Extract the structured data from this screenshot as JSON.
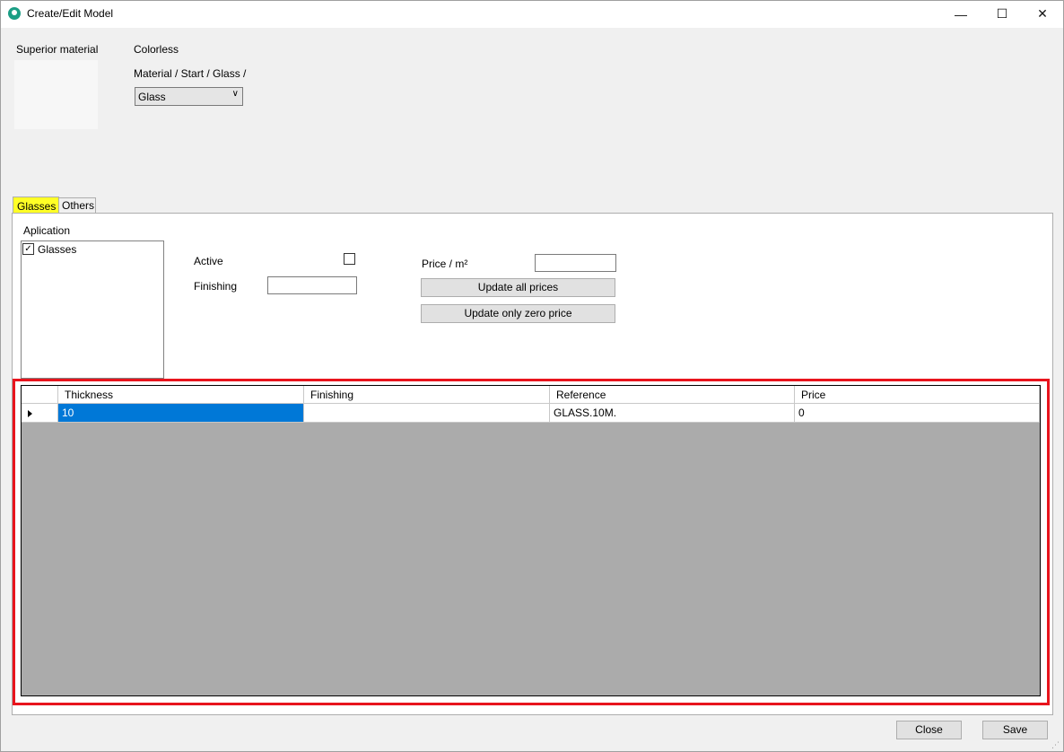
{
  "window": {
    "title": "Create/Edit Model",
    "minimize_glyph": "—",
    "maximize_glyph": "☐",
    "close_glyph": "✕"
  },
  "header": {
    "superior_material_label": "Superior material",
    "color_name": "Colorless",
    "material_path": "Material / Start / Glass /",
    "material_select": {
      "value": "Glass"
    }
  },
  "tabs": [
    {
      "label": "Glasses",
      "selected": true,
      "highlight_color": "#ffff26"
    },
    {
      "label": "Others",
      "selected": false
    }
  ],
  "form": {
    "aplication_label": "Aplication",
    "aplication_items": [
      {
        "label": "Glasses",
        "checked": true
      }
    ],
    "active_label": "Active",
    "active_checked": false,
    "finishing_label": "Finishing",
    "finishing_value": "",
    "price_label": "Price / m²",
    "price_value": "",
    "update_all_label": "Update all prices",
    "update_zero_label": "Update only zero price"
  },
  "grid": {
    "columns": [
      "Thickness",
      "Finishing",
      "Reference",
      "Price"
    ],
    "rows": [
      {
        "thickness": "10",
        "finishing": "",
        "reference": "GLASS.10M.",
        "price": "0"
      }
    ],
    "selection_color": "#0078d7",
    "highlight_border_color": "#e8141d"
  },
  "footer": {
    "close_label": "Close",
    "save_label": "Save"
  }
}
